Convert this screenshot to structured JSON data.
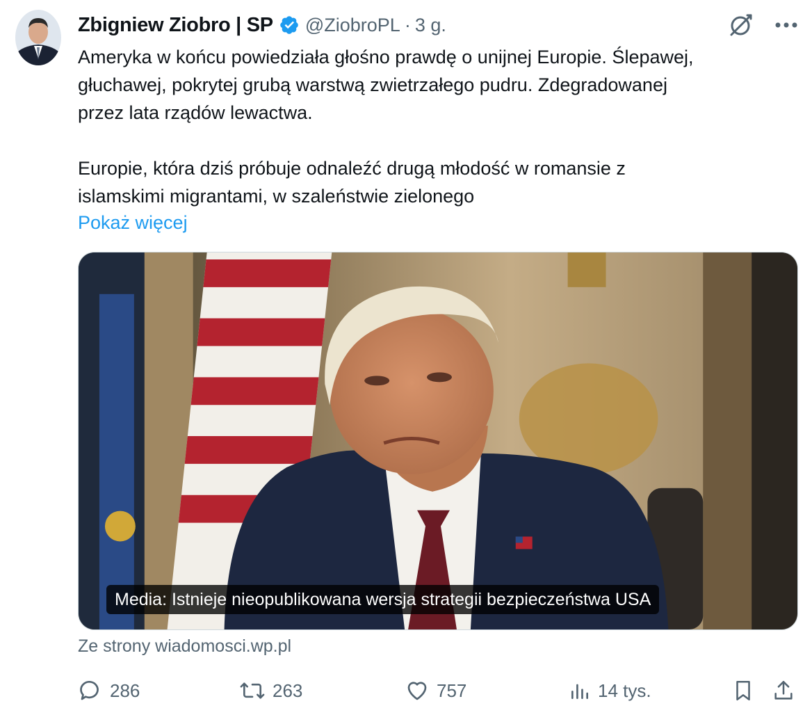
{
  "tweet": {
    "author_name": "Zbigniew Ziobro | SP",
    "handle": "@ZiobroPL",
    "separator": "·",
    "time": "3 g.",
    "text": "Ameryka w końcu powiedziała głośno prawdę o unijnej Europie. Ślepawej,\ngłuchawej, pokrytej grubą warstwą zwietrzałego pudru. Zdegradowanej\nprzez lata rządów lewactwa.\n\nEuropie, która dziś próbuje odnaleźć drugą młodość w romansie z\nislamskimi migrantami, w szaleństwie zielonego",
    "show_more": "Pokaż więcej"
  },
  "media": {
    "caption": "Media: Istnieje nieopublikowana wersja strategii bezpieczeństwa USA",
    "source": "Ze strony wiadomosci.wp.pl"
  },
  "actions": {
    "replies": "286",
    "reposts": "263",
    "likes": "757",
    "views": "14 tys."
  },
  "icons": {
    "verified": "verified-badge-icon",
    "grok": "grok-icon",
    "more": "more-icon",
    "reply": "reply-icon",
    "repost": "repost-icon",
    "like": "like-icon",
    "views": "views-icon",
    "bookmark": "bookmark-icon",
    "share": "share-icon"
  },
  "colors": {
    "accent": "#1d9bf0",
    "text": "#0f1419",
    "muted": "#536471"
  }
}
